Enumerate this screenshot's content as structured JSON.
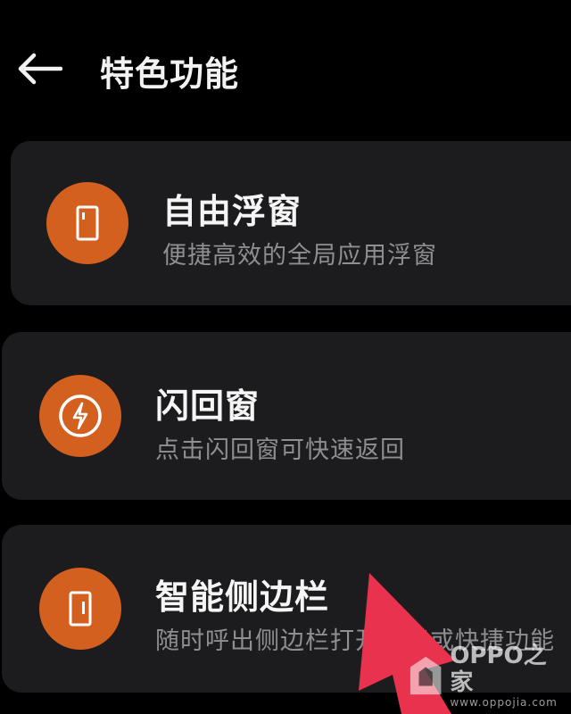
{
  "header": {
    "back_icon": "arrow-left-icon",
    "title": "特色功能"
  },
  "features": [
    {
      "title": "自由浮窗",
      "subtitle": "便捷高效的全局应用浮窗",
      "icon": "floating-window-icon",
      "icon_color": "#d4601f"
    },
    {
      "title": "闪回窗",
      "subtitle": "点击闪回窗可快速返回",
      "icon": "lightning-bolt-icon",
      "icon_color": "#d4601f"
    },
    {
      "title": "智能侧边栏",
      "subtitle": "随时呼出侧边栏打开应用或快捷功能",
      "icon": "sidebar-icon",
      "icon_color": "#d4601f"
    }
  ],
  "annotation": {
    "arrow_color": "#e8324e"
  },
  "watermark": {
    "brand": "OPPO之家",
    "url": "www.oppojia.com"
  },
  "colors": {
    "background": "#000000",
    "card": "#1c1c1e",
    "accent": "#d4601f",
    "subtitle": "#8e8e93"
  }
}
